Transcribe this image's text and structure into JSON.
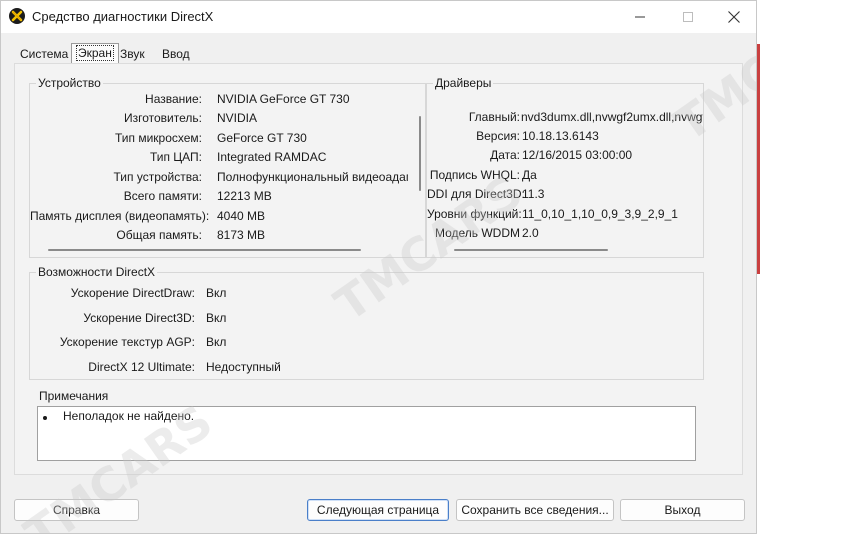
{
  "window": {
    "title": "Средство диагностики DirectX",
    "icon": "directx-icon"
  },
  "tabs": [
    {
      "label": "Система",
      "active": false
    },
    {
      "label": "Экран",
      "active": true
    },
    {
      "label": "Звук",
      "active": false
    },
    {
      "label": "Ввод",
      "active": false
    }
  ],
  "device": {
    "title": "Устройство",
    "rows": [
      {
        "label": "Название:",
        "value": "NVIDIA GeForce GT 730"
      },
      {
        "label": "Изготовитель:",
        "value": "NVIDIA"
      },
      {
        "label": "Тип микросхем:",
        "value": "GeForce GT 730"
      },
      {
        "label": "Тип ЦАП:",
        "value": "Integrated RAMDAC"
      },
      {
        "label": "Тип устройства:",
        "value": "Полнофункциональный видеоадаптер"
      },
      {
        "label": "Всего памяти:",
        "value": "12213 MB"
      },
      {
        "label": "Память дисплея (видеопамять):",
        "value": "4040 MB"
      },
      {
        "label": "Общая память:",
        "value": "8173 MB"
      }
    ]
  },
  "drivers": {
    "title": "Драйверы",
    "rows": [
      {
        "label": "Главный:",
        "value": "nvd3dumx.dll,nvwgf2umx.dll,nvwgf2umx.dll"
      },
      {
        "label": "Версия:",
        "value": "10.18.13.6143"
      },
      {
        "label": "Дата:",
        "value": "12/16/2015 03:00:00"
      },
      {
        "label": "Подпись WHQL:",
        "value": "Да"
      },
      {
        "label": "DDI для Direct3D:",
        "value": "11.3"
      },
      {
        "label": "Уровни функций:",
        "value": "11_0,10_1,10_0,9_3,9_2,9_1"
      },
      {
        "label": "Модель WDDM",
        "value": "2.0"
      }
    ]
  },
  "directx_features": {
    "title": "Возможности DirectX",
    "rows": [
      {
        "label": "Ускорение DirectDraw:",
        "value": "Вкл"
      },
      {
        "label": "Ускорение Direct3D:",
        "value": "Вкл"
      },
      {
        "label": "Ускорение текстур AGP:",
        "value": "Вкл"
      },
      {
        "label": "DirectX 12 Ultimate:",
        "value": "Недоступный"
      }
    ]
  },
  "notes": {
    "title": "Примечания",
    "items": [
      "Неполадок не найдено."
    ]
  },
  "buttons": {
    "help": "Справка",
    "next_page": "Следующая страница",
    "save_all": "Сохранить все сведения...",
    "exit": "Выход"
  },
  "watermark": "TMCARS"
}
